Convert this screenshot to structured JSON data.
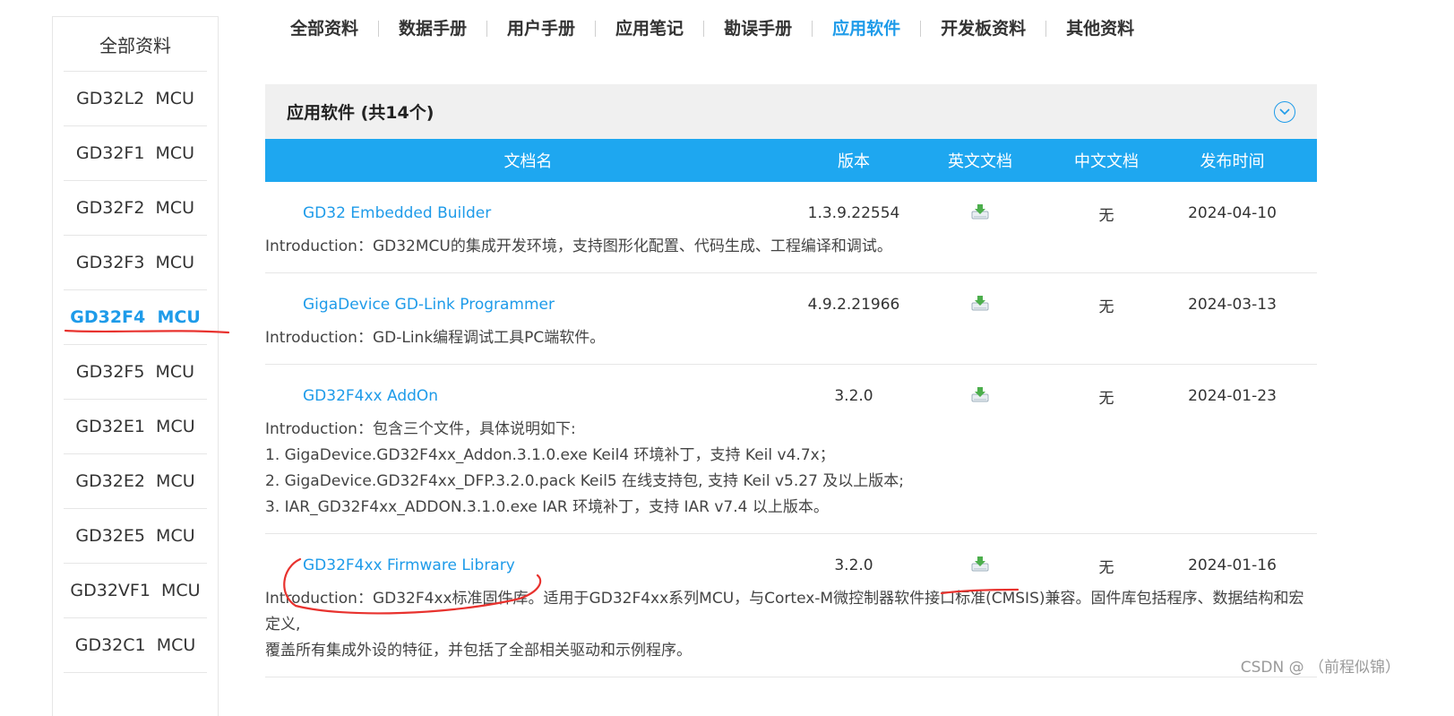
{
  "sidebar": {
    "title": "全部资料",
    "items": [
      {
        "label": "GD32L2  MCU",
        "active": false
      },
      {
        "label": "GD32F1  MCU",
        "active": false
      },
      {
        "label": "GD32F2  MCU",
        "active": false
      },
      {
        "label": "GD32F3  MCU",
        "active": false
      },
      {
        "label": "GD32F4  MCU",
        "active": true
      },
      {
        "label": "GD32F5  MCU",
        "active": false
      },
      {
        "label": "GD32E1  MCU",
        "active": false
      },
      {
        "label": "GD32E2  MCU",
        "active": false
      },
      {
        "label": "GD32E5  MCU",
        "active": false
      },
      {
        "label": "GD32VF1  MCU",
        "active": false
      },
      {
        "label": "GD32C1  MCU",
        "active": false
      }
    ]
  },
  "topnav": {
    "items": [
      {
        "label": "全部资料",
        "active": false
      },
      {
        "label": "数据手册",
        "active": false
      },
      {
        "label": "用户手册",
        "active": false
      },
      {
        "label": "应用笔记",
        "active": false
      },
      {
        "label": "勘误手册",
        "active": false
      },
      {
        "label": "应用软件",
        "active": true
      },
      {
        "label": "开发板资料",
        "active": false
      },
      {
        "label": "其他资料",
        "active": false
      }
    ]
  },
  "panel": {
    "title": "应用软件 (共14个)",
    "columns": {
      "name": "文档名",
      "version": "版本",
      "en_doc": "英文文档",
      "cn_doc": "中文文档",
      "date": "发布时间"
    },
    "rows": [
      {
        "name": "GD32 Embedded Builder",
        "version": "1.3.9.22554",
        "cn_doc": "无",
        "date": "2024-04-10",
        "intro": [
          "Introduction：GD32MCU的集成开发环境，支持图形化配置、代码生成、工程编译和调试。"
        ]
      },
      {
        "name": "GigaDevice GD-Link Programmer",
        "version": "4.9.2.21966",
        "cn_doc": "无",
        "date": "2024-03-13",
        "intro": [
          "Introduction：GD-Link编程调试工具PC端软件。"
        ]
      },
      {
        "name": "GD32F4xx AddOn",
        "version": "3.2.0",
        "cn_doc": "无",
        "date": "2024-01-23",
        "intro": [
          "Introduction：包含三个文件，具体说明如下:",
          "1. GigaDevice.GD32F4xx_Addon.3.1.0.exe Keil4 环境补丁，支持 Keil v4.7x；",
          "2. GigaDevice.GD32F4xx_DFP.3.2.0.pack Keil5 在线支持包, 支持 Keil v5.27 及以上版本;",
          "3. IAR_GD32F4xx_ADDON.3.1.0.exe IAR 环境补丁，支持 IAR v7.4 以上版本。"
        ]
      },
      {
        "name": "GD32F4xx Firmware Library",
        "version": "3.2.0",
        "cn_doc": "无",
        "date": "2024-01-16",
        "intro": [
          "Introduction：GD32F4xx标准固件库。适用于GD32F4xx系列MCU，与Cortex-M微控制器软件接口标准(CMSIS)兼容。固件库包括程序、数据结构和宏定义,",
          "覆盖所有集成外设的特征，并包括了全部相关驱动和示例程序。"
        ]
      }
    ]
  },
  "watermark": "CSDN @ （前程似锦）",
  "colors": {
    "accent": "#1e9be9",
    "header_bg": "#1ea7f0",
    "annotation": "#e8322e",
    "download_icon": "#4cae4c"
  },
  "icons": {
    "download": "download-icon",
    "collapse": "chevron-down-circle-icon"
  }
}
